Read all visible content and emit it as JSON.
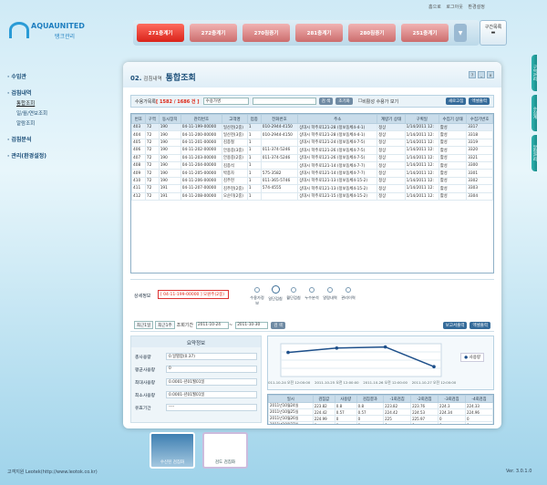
{
  "toplinks": [
    "홈으로",
    "로그아웃",
    "환경설정"
  ],
  "logo": {
    "name": "AQUAUNITED",
    "sub": "탱크관리"
  },
  "tanks": [
    "271충계기",
    "272충계기",
    "270침증기",
    "281충계기",
    "280침증기",
    "251충계기"
  ],
  "tank_active": 0,
  "tank_list_label": "구간목록",
  "nav": [
    {
      "group": "· 수입관",
      "subs": []
    },
    {
      "group": "· 검침내역",
      "subs": [
        "통합조회",
        "일/월/연보조회",
        "알람조회"
      ]
    },
    {
      "group": "· 검침분석",
      "subs": []
    },
    {
      "group": "· 관리(환경설정)",
      "subs": []
    }
  ],
  "page": {
    "num": "02.",
    "sub": "검침내역",
    "title": "통합조회"
  },
  "filter": {
    "label": "수용가목록",
    "count": "[ 1582 / 1686 건 ]",
    "select": "수용가명",
    "search_btn": "검 색",
    "reset_btn": "초기화",
    "checkbox": "비활성 수용가 보기",
    "new_btn": "새로고침",
    "excel_btn": "엑셀출력"
  },
  "grid": {
    "headers": [
      "번호",
      "구역",
      "동시장치",
      "관리번호",
      "고객명",
      "업종",
      "전화번호",
      "주소",
      "계량기 상태",
      "구획일",
      "수집기 상태",
      "수집기번호"
    ],
    "rows": [
      [
        "403",
        "72",
        "190",
        "04-11-199-00000",
        "일산천(2중)",
        "1",
        "010-2944-4150",
        "상대시 학주로121-28 (정보동체4-4-1)",
        "정상",
        "1/14/2011 12:",
        "활성",
        "3317"
      ],
      [
        "404",
        "72",
        "190",
        "04-11-200-00000",
        "일산천(3중)",
        "1",
        "010-2944-4150",
        "상대시 학주로121-28 (정보동체4-4-1)",
        "정상",
        "1/14/2011 12:",
        "활성",
        "3318"
      ],
      [
        "405",
        "72",
        "190",
        "04-11-201-00000",
        "김종철",
        "1",
        "",
        "상대시 학주로121-24 (정보동체4-7-5)",
        "정상",
        "1/14/2011 12:",
        "활성",
        "3319"
      ],
      [
        "406",
        "72",
        "190",
        "04-11-202-00000",
        "안용중(3중)",
        "1",
        "011-374-5246",
        "상대시 학주로121-26 (정보동체4-7-5)",
        "정상",
        "1/14/2011 12:",
        "활성",
        "3320"
      ],
      [
        "407",
        "72",
        "190",
        "04-11-203-00000",
        "안용중(2중)",
        "1",
        "011-374-5246",
        "상대시 학주로121-26 (정보동체4-7-5)",
        "정상",
        "1/14/2011 12:",
        "활성",
        "3321"
      ],
      [
        "408",
        "72",
        "190",
        "04-11-204-00000",
        "김종석",
        "1",
        "",
        "상대시 학주로121-14 (정보동체4-7-7)",
        "정상",
        "1/14/2011 12:",
        "활성",
        "3300"
      ],
      [
        "409",
        "72",
        "190",
        "04-11-205-00000",
        "박종자",
        "1",
        "575-3582",
        "상대시 학주로121-14 (정보동체4-7-7)",
        "정상",
        "1/14/2011 12:",
        "활성",
        "3301"
      ],
      [
        "410",
        "72",
        "190",
        "04-11-206-00000",
        "김주현",
        "1",
        "011-365-5746",
        "상대시 학주로121-13 (정보동체4-15-2)",
        "정상",
        "1/14/2011 12:",
        "활성",
        "3302"
      ],
      [
        "411",
        "72",
        "191",
        "04-11-207-00000",
        "김주현(2중)",
        "1",
        "574-4555",
        "상대시 학주로121-13 (정보동체4-15-2)",
        "정상",
        "1/14/2011 12:",
        "활성",
        "3303"
      ],
      [
        "412",
        "72",
        "191",
        "04-11-208-00000",
        "오순미(2중)",
        "1",
        "",
        "상대시 학주로121-15 (정보동체4-15-2)",
        "정상",
        "1/14/2011 12:",
        "활성",
        "3304"
      ]
    ],
    "selected_row": 0
  },
  "flow": {
    "label": "상세정보",
    "record": "[ 04-11-199-00000 ] 오원주(2중)",
    "steps": [
      "수용가정보",
      "일단검침",
      "월단검침",
      "누수분석",
      "알람내역",
      "관리이력"
    ],
    "active_step": 1
  },
  "period": {
    "tabs": [
      "최근1일",
      "최근1주",
      "조회기간"
    ],
    "from": "2011-10-24",
    "to": "2011-10-30",
    "btn": "검 색",
    "report_btn": "보고서출력",
    "excel_btn": "엑셀출력"
  },
  "summary": {
    "title": "요약정보",
    "rows": [
      {
        "k": "총사용량",
        "v": "0.일별합(0.37)"
      },
      {
        "k": "평균사용량",
        "v": "0"
      },
      {
        "k": "최대사용량",
        "v": "0.0001-년01월01일"
      },
      {
        "k": "최소사용량",
        "v": "0.0001-년01월01일"
      },
      {
        "k": "유효기간",
        "v": "----"
      }
    ]
  },
  "chart_data": {
    "type": "line",
    "categories": [
      "2011-10-24 오전 12:00:00",
      "2011-10-25 오전 12:00:00",
      "2011-10-26 오전 12:00:00",
      "2011-10-27 오전 12:00:00"
    ],
    "series": [
      {
        "name": "사용량",
        "values": [
          0.22,
          0.26,
          0.27,
          0.09
        ]
      }
    ],
    "legend": "right",
    "grid": true
  },
  "dtable": {
    "headers": [
      "일시",
      "검침값",
      "사용량",
      "검침결과",
      "-1회검침",
      "-2회검침",
      "-3회검침",
      "-4회검침"
    ],
    "rows": [
      [
        "2011년10월24일",
        "223.82",
        "0.8",
        "0.8",
        "223.82",
        "223.76",
        "224.3",
        "224.33"
      ],
      [
        "2011년10월25일",
        "224.42",
        "0.57",
        "0.57",
        "224.42",
        "224.53",
        "224.34",
        "224.96"
      ],
      [
        "2011년10월26일",
        "224.99",
        "0",
        "0",
        "225",
        "225.97",
        "0",
        "0"
      ],
      [
        "2011년10월27일",
        "0",
        "0",
        "0",
        "0",
        "0",
        "0",
        "0"
      ],
      [
        "2011년10월28일",
        "0",
        "0",
        "0",
        "0",
        "0",
        "0",
        "0"
      ]
    ]
  },
  "thumbs": [
    "수신된 검침화",
    "검도 검침화"
  ],
  "footer": "고객지원 Leotek(http://www.leotok.co.kr)",
  "version": "Ver. 3.0.1.0",
  "right_tabs": [
    "구역관리",
    "수집계",
    "알림관리"
  ]
}
